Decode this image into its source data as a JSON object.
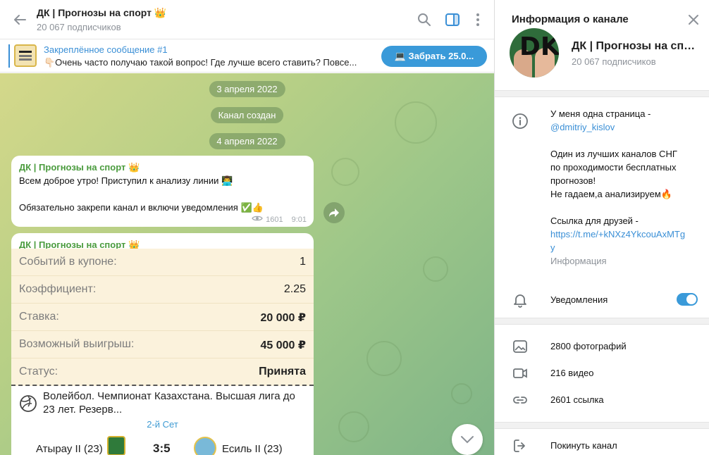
{
  "header": {
    "title": "ДК | Прогнозы на спорт 👑",
    "subscribers": "20 067 подписчиков"
  },
  "pinned": {
    "title": "Закреплённое сообщение #1",
    "text": "👇🏻Очень часто получаю такой вопрос! Где лучше всего ставить? Повсе...",
    "button": "💻 Забрать 25.0..."
  },
  "dates": [
    "3 апреля 2022",
    "Канал создан",
    "4 апреля 2022"
  ],
  "message1": {
    "author": "ДК | Прогнозы на спорт 👑",
    "line1": "Всем доброе утро! Приступил к анализу линии 👨‍💻",
    "line2": "Обязательно закрепи канал и включи уведомления ✅👍",
    "views": "1601",
    "time": "9:01"
  },
  "message2": {
    "author": "ДК | Прогнозы на спорт 👑",
    "rows": [
      {
        "label": "Событий в купоне:",
        "value": "1"
      },
      {
        "label": "Коэффициент:",
        "value": "2.25"
      },
      {
        "label": "Ставка:",
        "value": "20 000 ₽"
      },
      {
        "label": "Возможный выигрыш:",
        "value": "45 000 ₽"
      },
      {
        "label": "Статус:",
        "value": "Принята"
      }
    ],
    "event": "Волейбол. Чемпионат Казахстана. Высшая лига до 23 лет. Резерв...",
    "set": "2-й Сет",
    "team1": "Атырау II (23)",
    "score": "3:5",
    "team2": "Есиль II (23)"
  },
  "info": {
    "title": "Информация о канале",
    "name": "ДК | Прогнозы на спорт 👑",
    "subscribers": "20 067 подписчиков",
    "about_line1": "У меня одна страница -",
    "about_link": "@dmitriy_kislov",
    "about_line2": "Один из лучших каналов СНГ",
    "about_line3": "по проходимости бесплатных",
    "about_line4": "прогнозов!",
    "about_line5": "Не гадаем,а анализируем🔥",
    "about_line6": "Ссылка для друзей -",
    "about_url1": "https://t.me/+kNXz4YkcouAxMTg",
    "about_url2": "y",
    "about_caption": "Информация",
    "notifications": "Уведомления",
    "photos": "2800 фотографий",
    "videos": "216 видео",
    "links": "2601 ссылка",
    "leave": "Покинуть канал"
  },
  "colors": {
    "accent": "#3a9ad9",
    "author": "#4a9b3d",
    "coupon_bg": "#fbf2dc"
  }
}
